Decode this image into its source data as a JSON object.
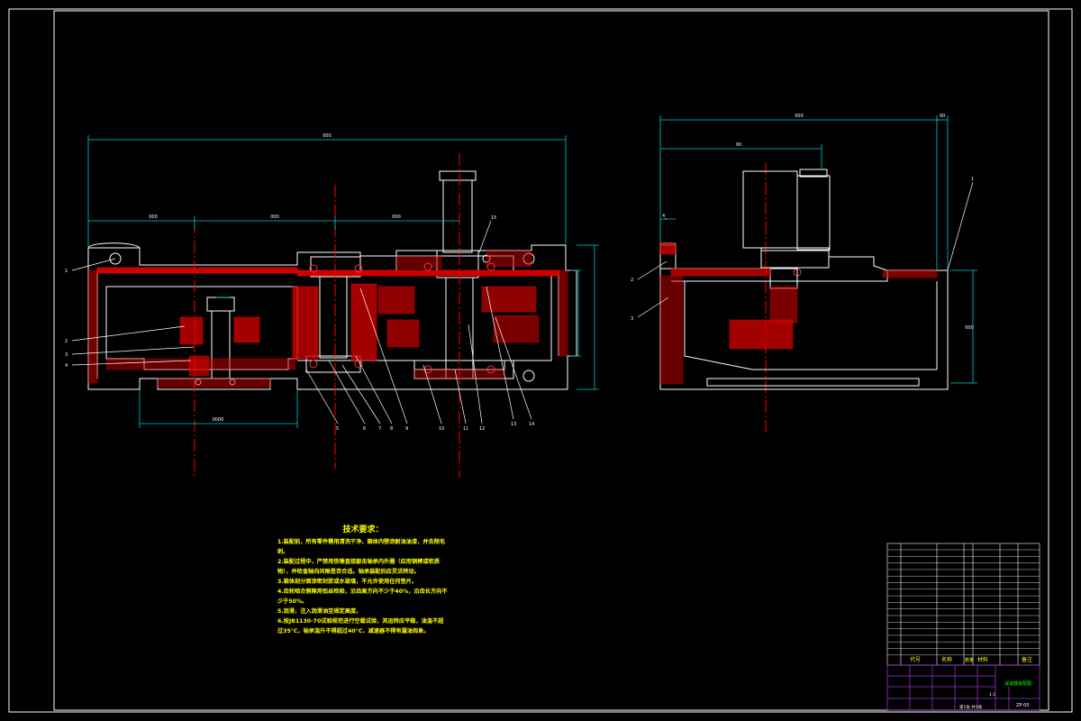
{
  "colors": {
    "background": "#000000",
    "outline": "#ffffff",
    "section": "#ff0000",
    "centerline": "#ff0000",
    "dimension": "#00ffff",
    "bearing": "#ff3333",
    "notes": "#ffff00",
    "titleblock": "#9933cc"
  },
  "technical_requirements": {
    "title": "技术要求：",
    "items": [
      "1.装配前，所有零件需用清洗干净，箱体内壁涂耐油油漆，并去除毛刺。",
      "2.装配过程中，严禁用铁锤直接敲击轴承内外圈（应用铜棒或软质物），并检查轴向间隙是否合适。轴承装配后应灵活转动。",
      "3.箱体剖分面涂密封胶或水玻璃，不允许使用任何垫片。",
      "4.齿轮啮合侧隙用铅丝检验，沿齿高方向不少于40%，沿齿长方向不少于50%。",
      "5.润滑，注入润滑油至规定高度。",
      "6.按JB1130-70试验规范进行空载试验，其运转应平稳，油温不超过35°C，轴承温升不得超过40°C，减速器不得有漏油现象。"
    ]
  },
  "main_view": {
    "overall_dim": "000",
    "sub_dims": [
      "000",
      "000",
      "000"
    ],
    "bottom_dim": "0000",
    "part_labels": [
      "1",
      "2",
      "3",
      "4",
      "5",
      "6",
      "7",
      "8",
      "9",
      "10",
      "11",
      "12",
      "13",
      "14",
      "15"
    ]
  },
  "side_view": {
    "overall_dim": "000",
    "sub_dims": [
      "00",
      "00"
    ],
    "height_dim": "000",
    "part_labels": [
      "1",
      "2",
      "3",
      "4"
    ]
  },
  "title_block": {
    "headers": [
      "代号",
      "名称",
      "数量",
      "材料",
      "备注"
    ],
    "drawing_name": "减速器装配图",
    "sheet": "第1张 共1张",
    "scale": "1:1",
    "drawing_no": "ZP-00"
  }
}
